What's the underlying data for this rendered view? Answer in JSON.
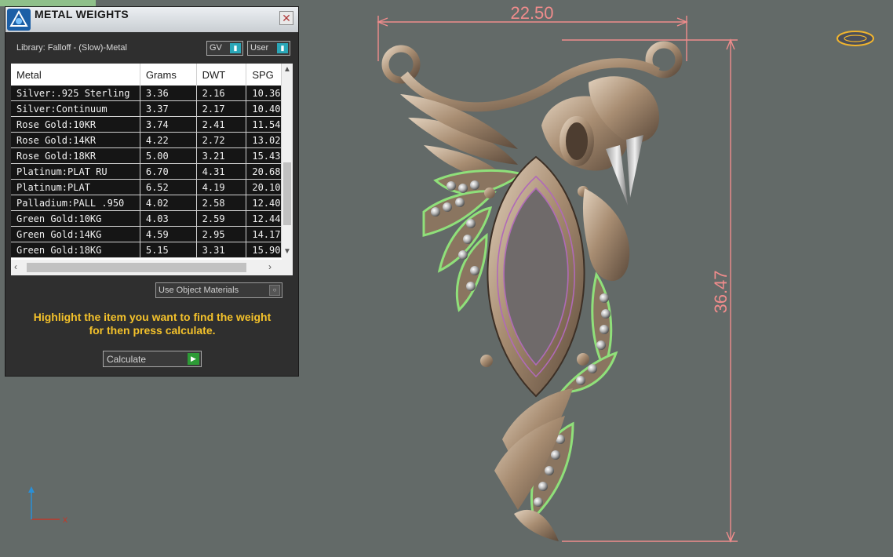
{
  "panel": {
    "title": "METAL WEIGHTS",
    "close_glyph": "✕",
    "library_label": "Library: Falloff - (Slow)-Metal",
    "gv_toggle": "GV",
    "user_toggle": "User",
    "use_materials_label": "Use Object Materials",
    "hint_line1": "Highlight the item you want to find the weight",
    "hint_line2": "for then press calculate.",
    "calculate_label": "Calculate"
  },
  "table": {
    "columns": [
      "Metal",
      "Grams",
      "DWT",
      "SPG"
    ],
    "rows": [
      [
        "Silver:.925 Sterling",
        "3.36",
        "2.16",
        "10.36"
      ],
      [
        "Silver:Continuum",
        "3.37",
        "2.17",
        "10.40"
      ],
      [
        "Rose Gold:10KR",
        "3.74",
        "2.41",
        "11.54"
      ],
      [
        "Rose Gold:14KR",
        "4.22",
        "2.72",
        "13.02"
      ],
      [
        "Rose Gold:18KR",
        "5.00",
        "3.21",
        "15.43"
      ],
      [
        "Platinum:PLAT RU",
        "6.70",
        "4.31",
        "20.68"
      ],
      [
        "Platinum:PLAT",
        "6.52",
        "4.19",
        "20.10"
      ],
      [
        "Palladium:PALL .950",
        "4.02",
        "2.58",
        "12.40"
      ],
      [
        "Green Gold:10KG",
        "4.03",
        "2.59",
        "12.44"
      ],
      [
        "Green Gold:14KG",
        "4.59",
        "2.95",
        "14.17"
      ],
      [
        "Green Gold:18KG",
        "5.15",
        "3.31",
        "15.90"
      ]
    ]
  },
  "viewport": {
    "width_dimension": "22.50",
    "height_dimension": "36.47",
    "axis_x_label": "x",
    "dimension_color": "#f08c8c",
    "metal_color": "#b59a7e",
    "selection_color": "#8fe07a"
  }
}
